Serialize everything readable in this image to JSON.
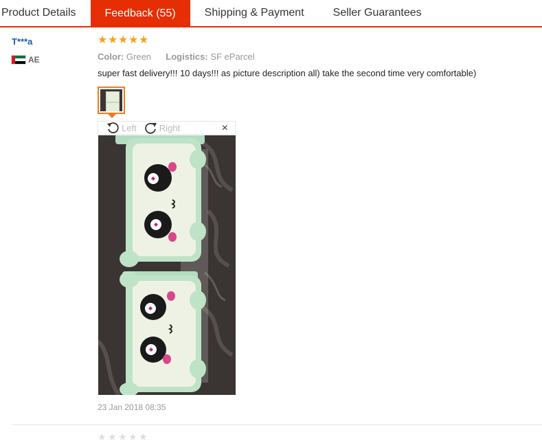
{
  "tabs": [
    {
      "label": "Product Details",
      "active": false
    },
    {
      "label": "Feedback (55)",
      "active": true
    },
    {
      "label": "Shipping & Payment",
      "active": false
    },
    {
      "label": "Seller Guarantees",
      "active": false
    }
  ],
  "review": {
    "reviewer": "T***a",
    "country_code": "AE",
    "rating": 5,
    "color_label": "Color:",
    "color_value": "Green",
    "logistics_label": "Logistics:",
    "logistics_value": "SF eParcel",
    "comment": "super fast delivery!!! 10 days!!! as picture description all) take the second time very comfortable)",
    "date": "23 Jan 2018 08:35"
  },
  "viewer": {
    "rotate_left": "Left",
    "rotate_right": "Right",
    "close": "×"
  },
  "colors": {
    "accent": "#e62e04",
    "star": "#f7a11a",
    "link": "#1a5eab"
  }
}
